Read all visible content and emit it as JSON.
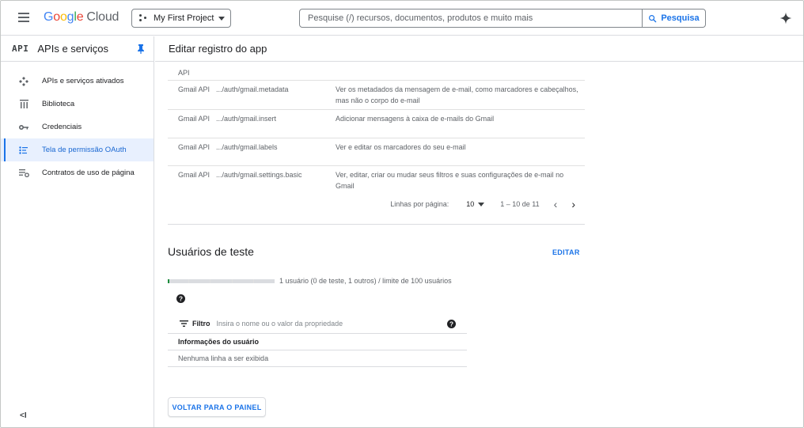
{
  "app": {
    "logo_letters": [
      "G",
      "o",
      "o",
      "g",
      "l",
      "e"
    ],
    "logo_suffix": "Cloud",
    "project_name": "My First Project",
    "search_placeholder": "Pesquise (/) recursos, documentos, produtos e muito mais",
    "search_button": "Pesquisa"
  },
  "sidebar": {
    "badge": "API",
    "title": "APIs e serviços",
    "items": [
      {
        "label": "APIs e serviços ativados",
        "icon": "api-hub-icon"
      },
      {
        "label": "Biblioteca",
        "icon": "library-icon"
      },
      {
        "label": "Credenciais",
        "icon": "key-icon"
      },
      {
        "label": "Tela de permissão OAuth",
        "icon": "oauth-consent-icon",
        "active": true
      },
      {
        "label": "Contratos de uso de página",
        "icon": "settings-list-icon"
      }
    ],
    "collapse_glyph": "<I"
  },
  "main": {
    "page_title": "Editar registro do app",
    "scopes": [
      {
        "api": "API",
        "scope": "",
        "desc": ""
      },
      {
        "api": "Gmail API",
        "scope": ".../auth/gmail.metadata",
        "desc": "Ver os metadados da mensagem de e-mail, como marcadores e cabeçalhos, mas não o corpo do e-mail"
      },
      {
        "api": "Gmail API",
        "scope": ".../auth/gmail.insert",
        "desc": "Adicionar mensagens à caixa de e-mails do Gmail"
      },
      {
        "api": "Gmail API",
        "scope": ".../auth/gmail.labels",
        "desc": "Ver e editar os marcadores do seu e-mail"
      },
      {
        "api": "Gmail API",
        "scope": ".../auth/gmail.settings.basic",
        "desc": "Ver, editar, criar ou mudar seus filtros e suas configurações de e-mail no Gmail"
      }
    ],
    "pager": {
      "rows_label": "Linhas por página:",
      "rows_value": "10",
      "range": "1 – 10 de 11",
      "prev": "‹",
      "next": "›"
    },
    "test_users": {
      "title": "Usuários de teste",
      "edit": "EDITAR",
      "usage_text": "1 usuário (0 de teste, 1 outros) / limite de 100 usuários",
      "usage_fraction": 0.01,
      "filter_label": "Filtro",
      "filter_placeholder": "Insira o nome ou o valor da propriedade",
      "column_header": "Informações do usuário",
      "empty_text": "Nenhuma linha a ser exibida"
    },
    "back_button": "VOLTAR PARA O PAINEL"
  }
}
